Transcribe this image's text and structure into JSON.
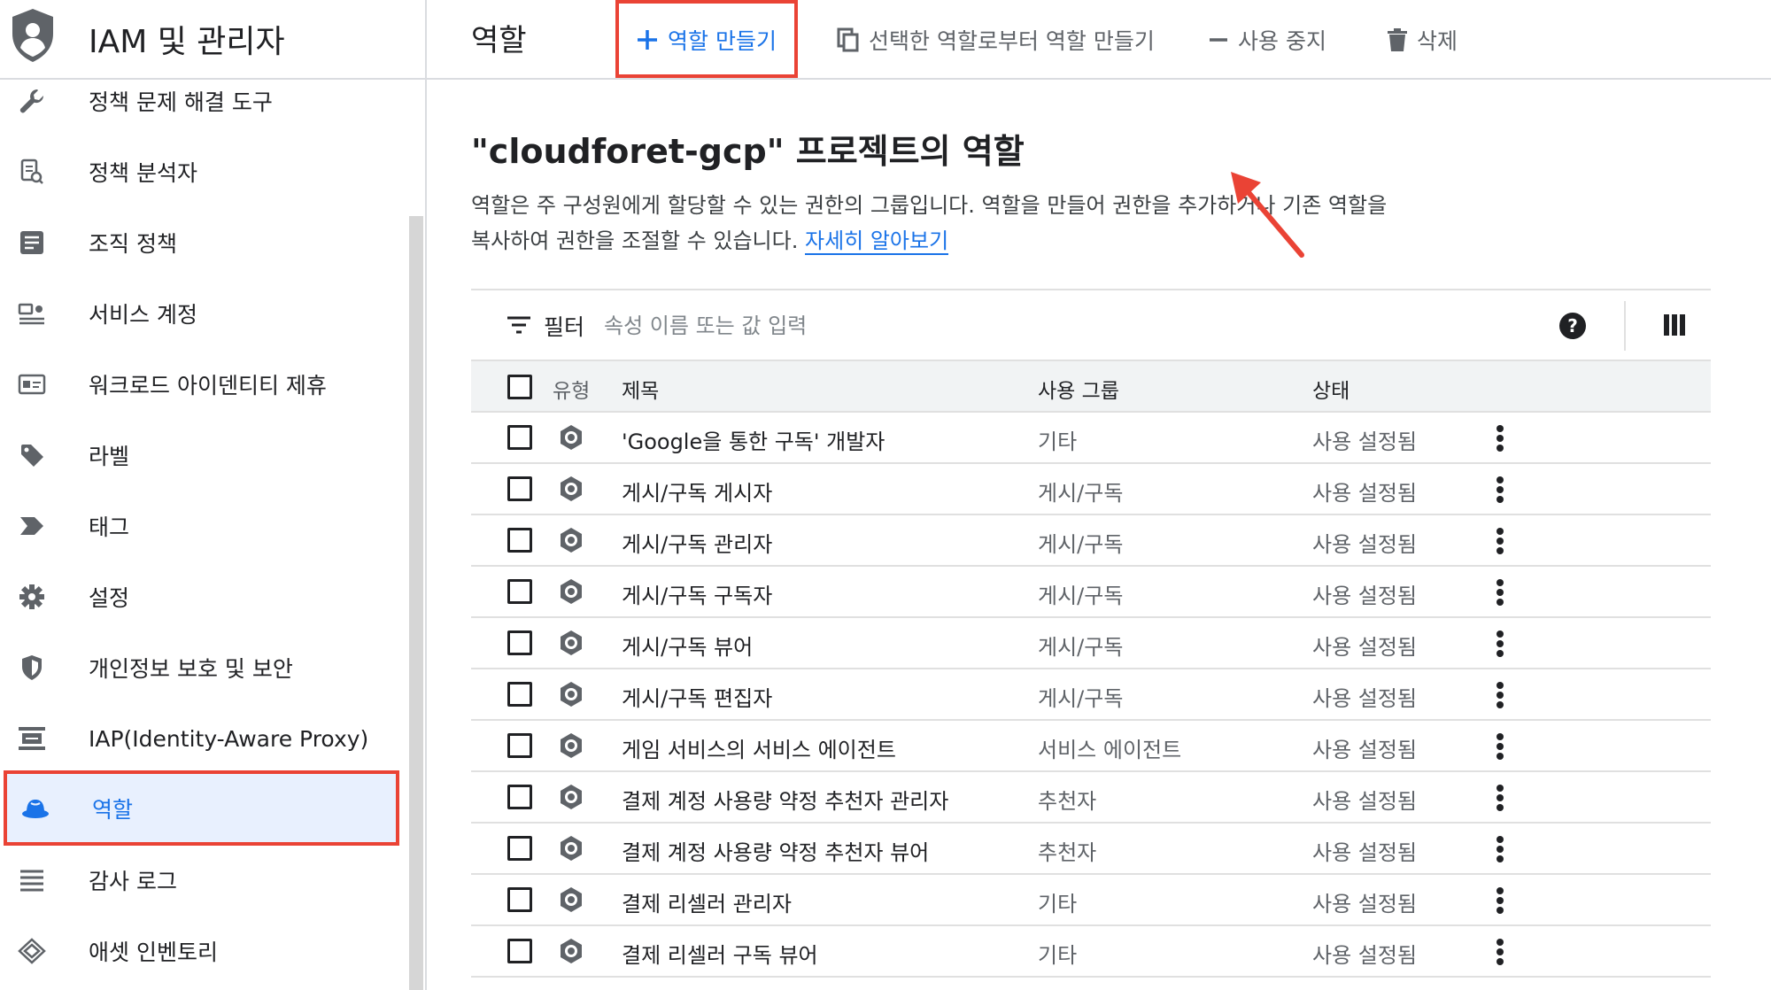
{
  "sidebar": {
    "title": "IAM 및 관리자",
    "items": [
      {
        "label": "정책 문제 해결 도구",
        "icon": "wrench-icon"
      },
      {
        "label": "정책 분석자",
        "icon": "policy-analyzer-icon"
      },
      {
        "label": "조직 정책",
        "icon": "document-icon"
      },
      {
        "label": "서비스 계정",
        "icon": "service-account-icon"
      },
      {
        "label": "워크로드 아이덴티티 제휴",
        "icon": "id-card-icon"
      },
      {
        "label": "라벨",
        "icon": "label-tag-icon"
      },
      {
        "label": "태그",
        "icon": "tag-arrow-icon"
      },
      {
        "label": "설정",
        "icon": "gear-icon"
      },
      {
        "label": "개인정보 보호 및 보안",
        "icon": "shield-icon"
      },
      {
        "label": "IAP(Identity-Aware Proxy)",
        "icon": "iap-icon"
      },
      {
        "label": "역할",
        "icon": "roles-hat-icon",
        "active": true
      },
      {
        "label": "감사 로그",
        "icon": "list-lines-icon"
      },
      {
        "label": "애셋 인벤토리",
        "icon": "diamond-stack-icon"
      }
    ]
  },
  "toolbar": {
    "page_title": "역할",
    "create_label": "역할 만들기",
    "create_from_selection_label": "선택한 역할로부터 역할 만들기",
    "disable_label": "사용 중지",
    "delete_label": "삭제"
  },
  "main": {
    "heading": "\"cloudforet-gcp\" 프로젝트의 역할",
    "description": "역할은 주 구성원에게 할당할 수 있는 권한의 그룹입니다. 역할을 만들어 권한을 추가하거나 기존 역할을 복사하여 권한을 조절할 수 있습니다.",
    "learn_more": "자세히 알아보기"
  },
  "filter": {
    "label": "필터",
    "placeholder": "속성 이름 또는 값 입력"
  },
  "table": {
    "headers": {
      "type": "유형",
      "title": "제목",
      "group": "사용 그룹",
      "status": "상태"
    },
    "rows": [
      {
        "title": "'Google을 통한 구독' 개발자",
        "group": "기타",
        "status": "사용 설정됨"
      },
      {
        "title": "게시/구독 게시자",
        "group": "게시/구독",
        "status": "사용 설정됨"
      },
      {
        "title": "게시/구독 관리자",
        "group": "게시/구독",
        "status": "사용 설정됨"
      },
      {
        "title": "게시/구독 구독자",
        "group": "게시/구독",
        "status": "사용 설정됨"
      },
      {
        "title": "게시/구독 뷰어",
        "group": "게시/구독",
        "status": "사용 설정됨"
      },
      {
        "title": "게시/구독 편집자",
        "group": "게시/구독",
        "status": "사용 설정됨"
      },
      {
        "title": "게임 서비스의 서비스 에이전트",
        "group": "서비스 에이전트",
        "status": "사용 설정됨"
      },
      {
        "title": "결제 계정 사용량 약정 추천자 관리자",
        "group": "추천자",
        "status": "사용 설정됨"
      },
      {
        "title": "결제 계정 사용량 약정 추천자 뷰어",
        "group": "추천자",
        "status": "사용 설정됨"
      },
      {
        "title": "결제 리셀러 관리자",
        "group": "기타",
        "status": "사용 설정됨"
      },
      {
        "title": "결제 리셀러 구독 뷰어",
        "group": "기타",
        "status": "사용 설정됨"
      }
    ]
  },
  "colors": {
    "accent": "#1a73e8",
    "highlight_annotation": "#ea4335",
    "active_bg": "#e8f0fe",
    "muted_text": "#5f6368",
    "header_bg": "#f1f3f4"
  }
}
